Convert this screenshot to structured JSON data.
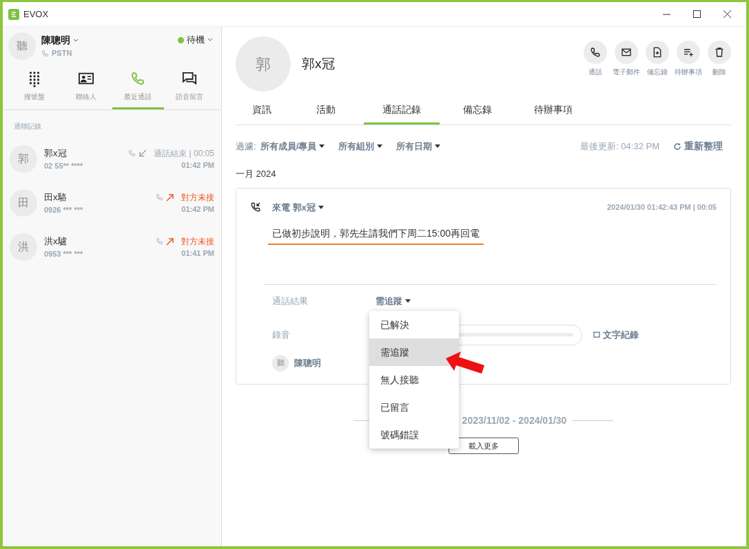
{
  "window": {
    "title": "EVOX"
  },
  "user": {
    "avatar": "聽",
    "name": "陳聰明",
    "line": "PSTN",
    "status": "待機"
  },
  "nav_tabs": [
    {
      "label": "撥號盤",
      "kind": "dialpad",
      "selected": false
    },
    {
      "label": "聯絡人",
      "kind": "contact",
      "selected": false
    },
    {
      "label": "最近通話",
      "kind": "phone",
      "selected": true
    },
    {
      "label": "語音留言",
      "kind": "chat",
      "selected": false
    }
  ],
  "section_label": "通聯記錄",
  "calls": [
    {
      "avatar": "郭",
      "name": "郭x冠",
      "number": "02 55** ****",
      "kind": "incoming",
      "missed": false,
      "result": "通話結束 | 00:05",
      "time": "01:42 PM"
    },
    {
      "avatar": "田",
      "name": "田x駱",
      "number": "0926 *** ***",
      "kind": "outgoing",
      "missed": true,
      "result": "對方未接",
      "time": "01:42 PM"
    },
    {
      "avatar": "洪",
      "name": "洪x驢",
      "number": "0953 *** ***",
      "kind": "outgoing",
      "missed": true,
      "result": "對方未接",
      "time": "01:41 PM"
    }
  ],
  "contact": {
    "avatar": "郭",
    "name": "郭x冠"
  },
  "actions": [
    {
      "label": "通話",
      "kind": "phone"
    },
    {
      "label": "電子郵件",
      "kind": "mail"
    },
    {
      "label": "備忘錄",
      "kind": "note"
    },
    {
      "label": "待辦事項",
      "kind": "todo"
    },
    {
      "label": "刪除",
      "kind": "trash"
    }
  ],
  "tabs": [
    {
      "label": "資訊",
      "selected": false
    },
    {
      "label": "活動",
      "selected": false
    },
    {
      "label": "通話記錄",
      "selected": true
    },
    {
      "label": "備忘錄",
      "selected": false
    },
    {
      "label": "待辦事項",
      "selected": false
    }
  ],
  "filters": {
    "label": "過濾:",
    "options": [
      "所有成員/專員",
      "所有組別",
      "所有日期"
    ]
  },
  "last_updated": "最後更新: 04:32 PM",
  "refresh": "重新整理",
  "month": "一月 2024",
  "record": {
    "title": "來電 郭x冠",
    "timestamp": "2024/01/30 01:42:43 PM | 00:05",
    "note": "已做初步說明，郭先生請我們下周二15:00再回電",
    "result_label": "通話結果",
    "result": "需追蹤",
    "recording_label": "錄音",
    "transcript": "文字紀錄",
    "agent_avatar": "聽",
    "agent": "陳聰明"
  },
  "dropdown": [
    {
      "label": "已解決",
      "selected": false
    },
    {
      "label": "需追蹤",
      "selected": true
    },
    {
      "label": "無人接聽",
      "selected": false
    },
    {
      "label": "已留言",
      "selected": false
    },
    {
      "label": "號碼錯誤",
      "selected": false
    }
  ],
  "range": "2023/11/02 - 2024/01/30",
  "load_more": "載入更多"
}
